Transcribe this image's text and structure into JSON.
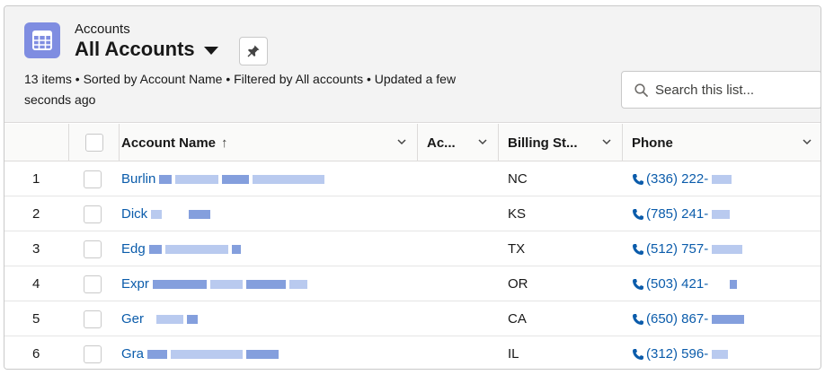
{
  "header": {
    "object_label": "Accounts",
    "list_name": "All Accounts",
    "meta_line1": "13 items • Sorted by Account Name • Filtered by All accounts • Updated a few",
    "meta_line2": "seconds ago",
    "search_placeholder": "Search this list..."
  },
  "columns": [
    {
      "label": "Account Name",
      "sorted": "ascending"
    },
    {
      "label": "Ac..."
    },
    {
      "label": "Billing St..."
    },
    {
      "label": "Phone"
    }
  ],
  "rows": [
    {
      "num": "1",
      "name": "Burlin",
      "state": "NC",
      "phone": "(336) 222-"
    },
    {
      "num": "2",
      "name": "Dick",
      "state": "KS",
      "phone": "(785) 241-"
    },
    {
      "num": "3",
      "name": "Edg",
      "state": "TX",
      "phone": "(512) 757-"
    },
    {
      "num": "4",
      "name": "Expr",
      "state": "OR",
      "phone": "(503) 421-"
    },
    {
      "num": "5",
      "name": "Ger",
      "state": "CA",
      "phone": "(650) 867-"
    },
    {
      "num": "6",
      "name": "Gra",
      "state": "IL",
      "phone": "(312) 596-"
    }
  ],
  "colors": {
    "link": "#0b5cab",
    "object_icon": "#7f8de1",
    "header_bg": "#f3f3f3"
  },
  "icons": {
    "object": "table-grid-icon",
    "pin": "pin-icon",
    "search": "search-icon",
    "phone": "phone-icon",
    "sort": "arrow-up-icon",
    "column_menu": "chevron-down-icon"
  }
}
